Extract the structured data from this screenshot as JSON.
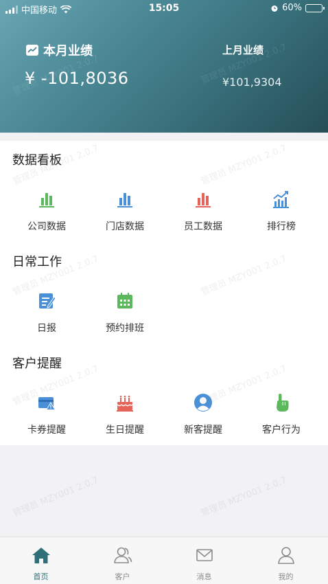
{
  "status_bar": {
    "carrier": "中国移动",
    "time": "15:05",
    "battery": "60%",
    "battery_level": 0.6
  },
  "header": {
    "current": {
      "title": "本月业绩",
      "value": "¥ -101,8036"
    },
    "last": {
      "title": "上月业绩",
      "value": "¥101,9304"
    }
  },
  "watermark": "管理员 MZY001 2.0.7",
  "sections": [
    {
      "title": "数据看板",
      "items": [
        {
          "label": "公司数据",
          "icon": "bar-chart-green-icon",
          "color": "#5cb85c"
        },
        {
          "label": "门店数据",
          "icon": "bar-chart-blue-icon",
          "color": "#4a90d9"
        },
        {
          "label": "员工数据",
          "icon": "bar-chart-red-icon",
          "color": "#e4645a"
        },
        {
          "label": "排行榜",
          "icon": "trend-chart-icon",
          "color": "#4a90d9"
        }
      ]
    },
    {
      "title": "日常工作",
      "items": [
        {
          "label": "日报",
          "icon": "daily-report-icon",
          "color": "#4a90d9"
        },
        {
          "label": "预约排班",
          "icon": "calendar-icon",
          "color": "#5cb85c"
        }
      ]
    },
    {
      "title": "客户提醒",
      "items": [
        {
          "label": "卡券提醒",
          "icon": "card-warning-icon",
          "color": "#4a90d9"
        },
        {
          "label": "生日提醒",
          "icon": "birthday-cake-icon",
          "color": "#e4645a"
        },
        {
          "label": "新客提醒",
          "icon": "new-customer-icon",
          "color": "#4a90d9"
        },
        {
          "label": "客户行为",
          "icon": "pointing-hand-icon",
          "color": "#5cb85c"
        }
      ]
    }
  ],
  "tabs": [
    {
      "label": "首页",
      "icon": "home-icon",
      "active": true
    },
    {
      "label": "客户",
      "icon": "customers-icon",
      "active": false
    },
    {
      "label": "消息",
      "icon": "message-icon",
      "active": false
    },
    {
      "label": "我的",
      "icon": "profile-icon",
      "active": false
    }
  ],
  "colors": {
    "brand": "#2f6f78",
    "header_gradient_start": "#6aa6b4",
    "header_gradient_end": "#264e57"
  }
}
